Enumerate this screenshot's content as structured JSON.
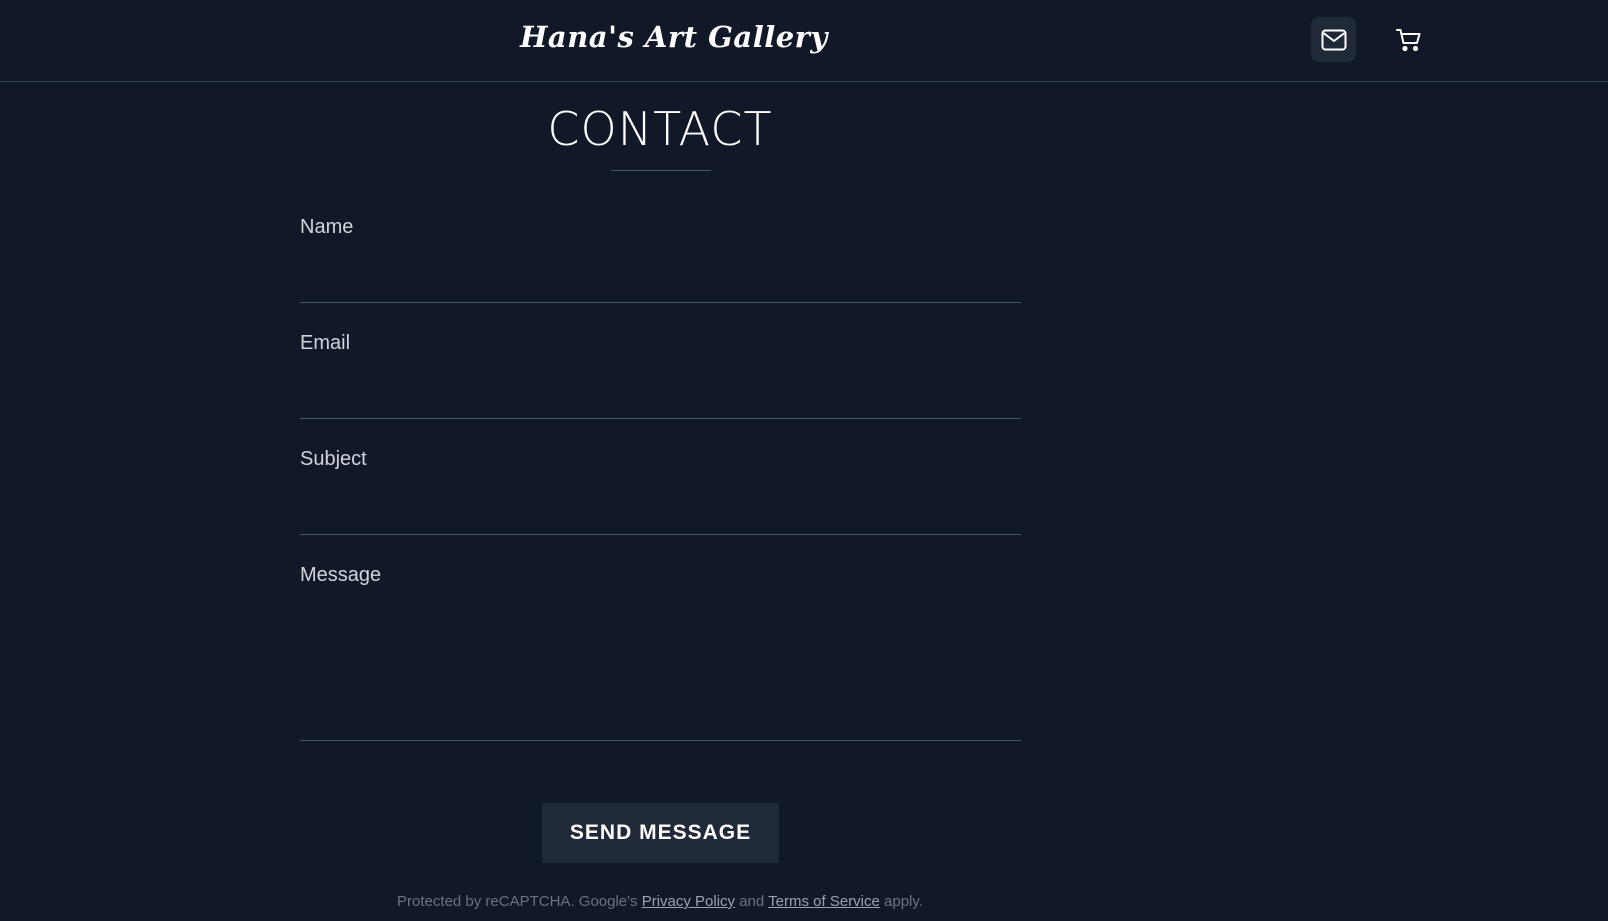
{
  "header": {
    "title": "Hana's Art Gallery",
    "mail_icon": "mail-icon",
    "cart_icon": "cart-icon"
  },
  "page": {
    "title": "CONTACT"
  },
  "form": {
    "name_label": "Name",
    "name_value": "",
    "email_label": "Email",
    "email_value": "",
    "subject_label": "Subject",
    "subject_value": "",
    "message_label": "Message",
    "message_value": "",
    "submit_label": "SEND MESSAGE"
  },
  "recaptcha": {
    "prefix": "Protected by reCAPTCHA. Google's ",
    "privacy_link": "Privacy Policy",
    "middle": " and ",
    "terms_link": "Terms of Service",
    "suffix": " apply."
  },
  "colors": {
    "background": "#111827",
    "button": "#1f2937",
    "divider": "#4b5563"
  }
}
